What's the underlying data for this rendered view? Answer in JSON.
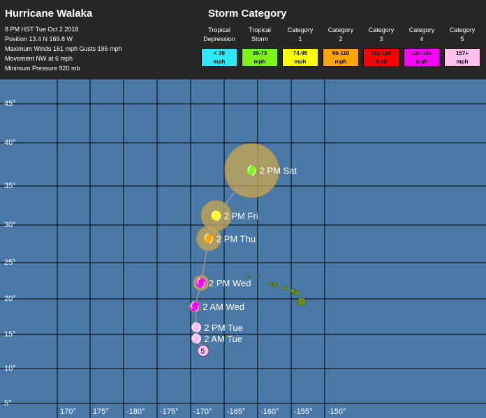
{
  "header": {
    "storm_name": "Hurricane Walaka",
    "info": [
      "8 PM HST Tue Oct 2 2018",
      "Position 13.4 N 169.8 W",
      "Maximum Winds 161 mph Gusts 196 mph",
      "Movement NW at 6 mph",
      "Minimum Pressure 920 mb"
    ]
  },
  "legend": {
    "title": "Storm Category",
    "categories": [
      {
        "line1": "Tropical",
        "line2": "Depression",
        "range": "< 39",
        "unit": "mph",
        "color": "#2ee8f5"
      },
      {
        "line1": "Tropical",
        "line2": "Storm",
        "range": "39-73",
        "unit": "mph",
        "color": "#7ef317"
      },
      {
        "line1": "Category",
        "line2": "1",
        "range": "74-95",
        "unit": "mph",
        "color": "#ffff00"
      },
      {
        "line1": "Category",
        "line2": "2",
        "range": "96-110",
        "unit": "mph",
        "color": "#ffa500"
      },
      {
        "line1": "Category",
        "line2": "3",
        "range": "111-129",
        "unit": "mph",
        "color": "#ff0000"
      },
      {
        "line1": "Category",
        "line2": "4",
        "range": "130-156",
        "unit": "mph",
        "color": "#ff00ff"
      },
      {
        "line1": "Category",
        "line2": "5",
        "range": "157+",
        "unit": "mph",
        "color": "#ffc0f0"
      }
    ]
  },
  "map": {
    "lat_labels": [
      "45°",
      "40°",
      "35°",
      "30°",
      "25°",
      "20°",
      "15°",
      "10°",
      "5°"
    ],
    "lon_labels": [
      "170°",
      "175°",
      "-180°",
      "-175°",
      "-170°",
      "-165°",
      "-160°",
      "-155°",
      "-150°"
    ],
    "track": [
      {
        "label": "2 PM Sat",
        "lat": 36.8,
        "lon": -162.9,
        "category": "Tropical Storm",
        "color": "#7ef317",
        "radius_mi": 180
      },
      {
        "label": "2 PM Fri",
        "lat": 31.2,
        "lon": -168.1,
        "category": "Category 1",
        "color": "#ffff00",
        "radius_mi": 100
      },
      {
        "label": "2 PM Thu",
        "lat": 28.2,
        "lon": -169.2,
        "category": "Category 2",
        "color": "#ffa500",
        "radius_mi": 80
      },
      {
        "label": "2 PM Wed",
        "lat": 22.2,
        "lon": -170.3,
        "category": "Category 4",
        "color": "#ff00ff",
        "radius_mi": 50
      },
      {
        "label": "2 AM Wed",
        "lat": 18.9,
        "lon": -171.2,
        "category": "Category 4",
        "color": "#ff00ff",
        "radius_mi": 35
      },
      {
        "label": "2 PM Tue",
        "lat": 16.0,
        "lon": -171.0,
        "category": "Category 5",
        "color": "#ffc0f0",
        "radius_mi": 0
      },
      {
        "label": "2 AM Tue",
        "lat": 14.4,
        "lon": -171.0,
        "category": "Category 5",
        "color": "#ffc0f0",
        "radius_mi": 0
      }
    ],
    "current": {
      "lat": 12.6,
      "lon": -170.0,
      "marker_text": "5",
      "color": "#ffc0f0"
    },
    "colors": {
      "ocean": "#4a79a8",
      "grid": "#000000",
      "land": "#6b8e23",
      "track_line": "#999999",
      "wind_field": "#c9a94f"
    }
  }
}
